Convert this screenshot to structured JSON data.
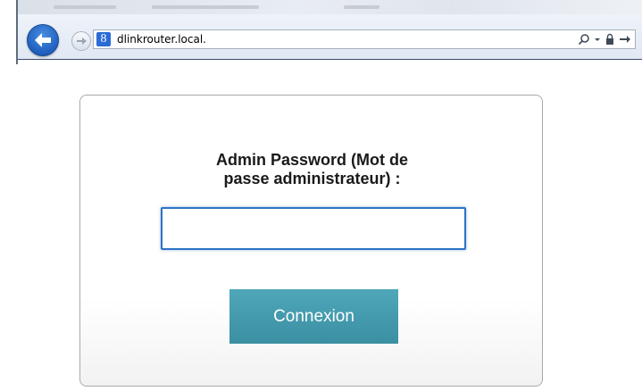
{
  "browser": {
    "address": {
      "url": "dlinkrouter.local.",
      "favicon_glyph": "8"
    },
    "icons": {
      "back": "back-arrow-icon",
      "forward": "forward-arrow-icon",
      "search": "search-icon",
      "dropdown": "dropdown-arrow-icon",
      "lock": "lock-icon",
      "go": "go-arrow-icon"
    }
  },
  "login": {
    "label_line1": "Admin Password (Mot de",
    "label_line2": "passe administrateur) :",
    "password_value": "",
    "button_label": "Connexion"
  },
  "colors": {
    "button": "#4a9eb1",
    "input_border": "#2d72c4",
    "back_button": "#1f5fbf"
  }
}
